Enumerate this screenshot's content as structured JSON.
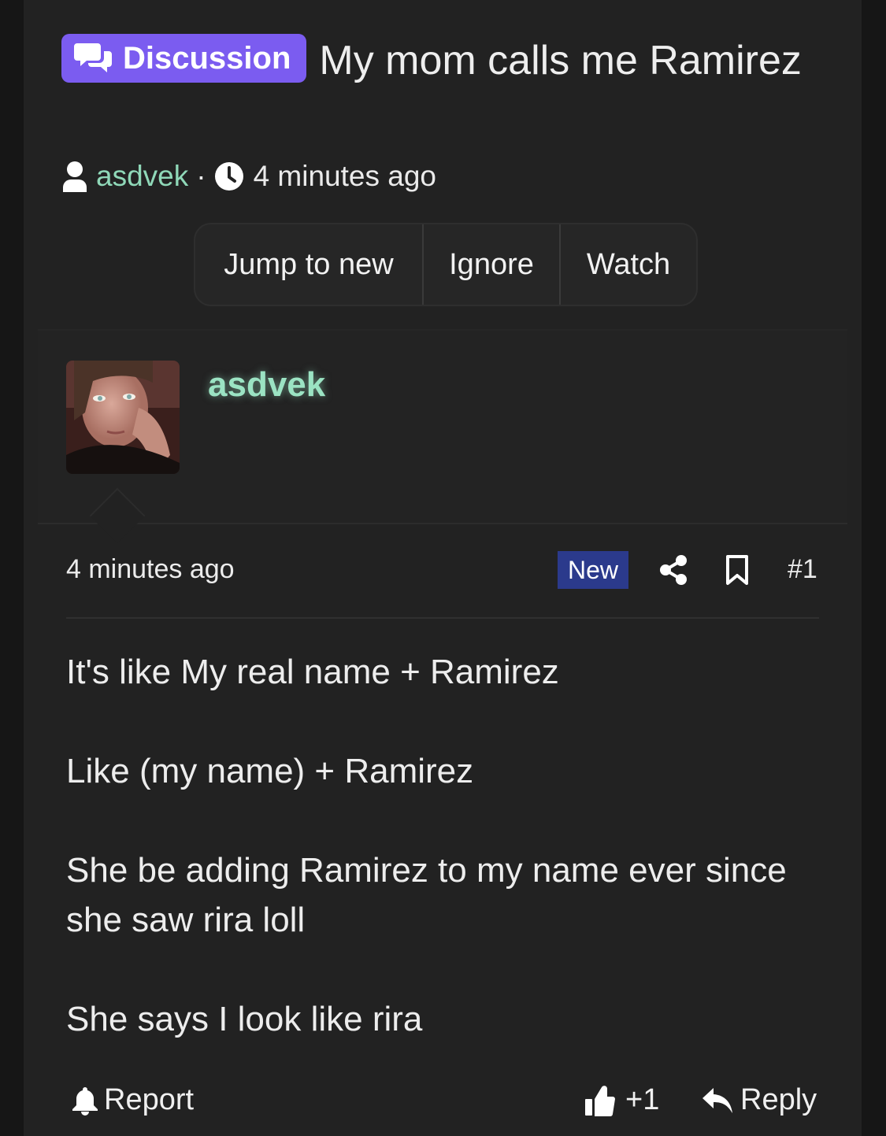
{
  "thread": {
    "prefix": "Discussion",
    "title": "My mom calls me Ramirez",
    "author": "asdvek",
    "separator": "·",
    "time_ago": "4 minutes ago"
  },
  "actions": {
    "jump_to_new": "Jump to new",
    "ignore": "Ignore",
    "watch": "Watch"
  },
  "post": {
    "username": "asdvek",
    "time_ago": "4 minutes ago",
    "new_badge": "New",
    "number": "#1",
    "paragraphs": [
      "It's like My real name + Ramirez",
      "Like (my name) + Ramirez",
      "She be adding Ramirez to my name ever since she saw rira loll",
      "She says I look like rira"
    ],
    "report_label": "Report",
    "reaction_label": "+1",
    "reply_label": "Reply"
  },
  "colors": {
    "prefix_badge": "#7b5cf0",
    "username": "#9be3c3",
    "new_badge": "#2b3a8c",
    "background": "#222222"
  },
  "icons": {
    "prefix": "chat-bubbles-icon",
    "author": "user-icon",
    "time": "clock-icon",
    "share": "share-icon",
    "bookmark": "bookmark-icon",
    "report": "bell-icon",
    "reaction": "thumbs-up-icon",
    "reply": "reply-arrow-icon"
  }
}
